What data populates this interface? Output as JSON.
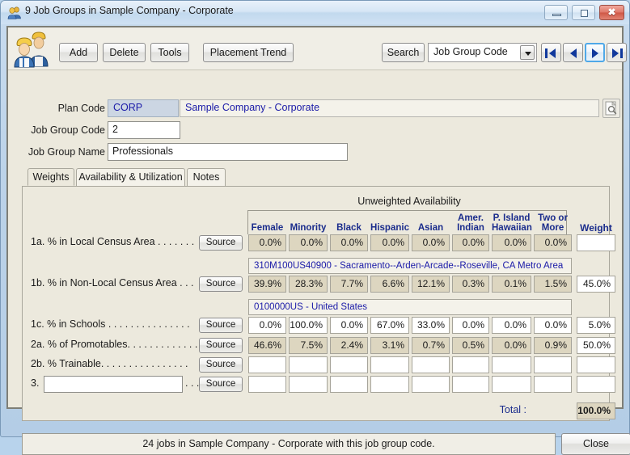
{
  "window": {
    "title": "9 Job Groups in Sample Company - Corporate",
    "icon": "people-group-icon",
    "minimize_label": "minimize-icon",
    "maximize_label": "maximize-icon",
    "close_label": "✖"
  },
  "toolbar": {
    "app_icon": "two-workers-icon",
    "add_label": "Add",
    "delete_label": "Delete",
    "tools_label": "Tools",
    "placement_trend_label": "Placement Trend",
    "search_label": "Search",
    "search_field_selected": "Job Group Code",
    "search_field_options": [
      "Job Group Code"
    ],
    "nav_first": "first-record-icon",
    "nav_prev": "previous-record-icon",
    "nav_next": "next-record-icon",
    "nav_last": "last-record-icon"
  },
  "form": {
    "plan_code_label": "Plan Code",
    "plan_code_value": "CORP",
    "plan_name_value": "Sample Company - Corporate",
    "plan_lookup_icon": "document-magnifier-icon",
    "job_group_code_label": "Job Group Code",
    "job_group_code_value": "2",
    "job_group_name_label": "Job Group Name",
    "job_group_name_value": "Professionals"
  },
  "tabs": [
    {
      "label": "Weights",
      "active": true
    },
    {
      "label": "Availability & Utilization",
      "active": false
    },
    {
      "label": "Notes",
      "active": false
    }
  ],
  "table": {
    "group_header": "Unweighted Availability",
    "columns": [
      {
        "line1": "Female",
        "line2": ""
      },
      {
        "line1": "Minority",
        "line2": ""
      },
      {
        "line1": "Black",
        "line2": ""
      },
      {
        "line1": "Hispanic",
        "line2": ""
      },
      {
        "line1": "Asian",
        "line2": ""
      },
      {
        "line1": "Amer.",
        "line2": "Indian"
      },
      {
        "line1": "P. Island",
        "line2": "Hawaiian"
      },
      {
        "line1": "Two or",
        "line2": "More"
      }
    ],
    "weight_header": "Weight",
    "source_button_label": "Source",
    "rows": [
      {
        "num": "1a.",
        "label": "% in Local Census Area",
        "dots": ". . . . . . .",
        "readonly": true,
        "values": [
          "0.0%",
          "0.0%",
          "0.0%",
          "0.0%",
          "0.0%",
          "0.0%",
          "0.0%",
          "0.0%"
        ],
        "weight": ""
      },
      {
        "num": "1b.",
        "label": "% in Non-Local Census Area",
        "dots": ". . .",
        "readonly": true,
        "values": [
          "39.9%",
          "28.3%",
          "7.7%",
          "6.6%",
          "12.1%",
          "0.3%",
          "0.1%",
          "1.5%"
        ],
        "weight": "45.0%"
      },
      {
        "num": "1c.",
        "label": "% in Schools",
        "dots": ". . . . . . . . . . . . . . .",
        "readonly": false,
        "values": [
          "0.0%",
          "100.0%",
          "0.0%",
          "67.0%",
          "33.0%",
          "0.0%",
          "0.0%",
          "0.0%"
        ],
        "weight": "5.0%"
      },
      {
        "num": "2a.",
        "label": "% of Promotables.",
        "dots": ". . . . . . . . . . . .",
        "readonly": true,
        "values": [
          "46.6%",
          "7.5%",
          "2.4%",
          "3.1%",
          "0.7%",
          "0.5%",
          "0.0%",
          "0.9%"
        ],
        "weight": "50.0%"
      },
      {
        "num": "2b.",
        "label": "% Trainable.",
        "dots": ". . . . . . . . . . . . . . .",
        "readonly": false,
        "values": [
          "",
          "",
          "",
          "",
          "",
          "",
          "",
          ""
        ],
        "weight": ""
      },
      {
        "num": "3.",
        "label": "",
        "dots": ". . .",
        "readonly": false,
        "custom_input": "",
        "values": [
          "",
          "",
          "",
          "",
          "",
          "",
          "",
          ""
        ],
        "weight": ""
      }
    ],
    "geo_bands": [
      {
        "after_row": 0,
        "text": "310M100US40900 - Sacramento--Arden-Arcade--Roseville, CA Metro Area"
      },
      {
        "after_row": 1,
        "text": "0100000US - United States"
      }
    ],
    "total_label": "Total :",
    "total_value": "100.0%"
  },
  "status": {
    "message": "24 jobs in Sample Company - Corporate with this job group code.",
    "close_label": "Close"
  },
  "colors": {
    "accent_blue": "#1a2c8c",
    "readonly_cell": "#ddd6c0",
    "panel_bg": "#ece9dd",
    "link_blue": "#1a1aa8",
    "nav_arrow": "#10389c",
    "focus_ring": "#4fa8e8"
  }
}
